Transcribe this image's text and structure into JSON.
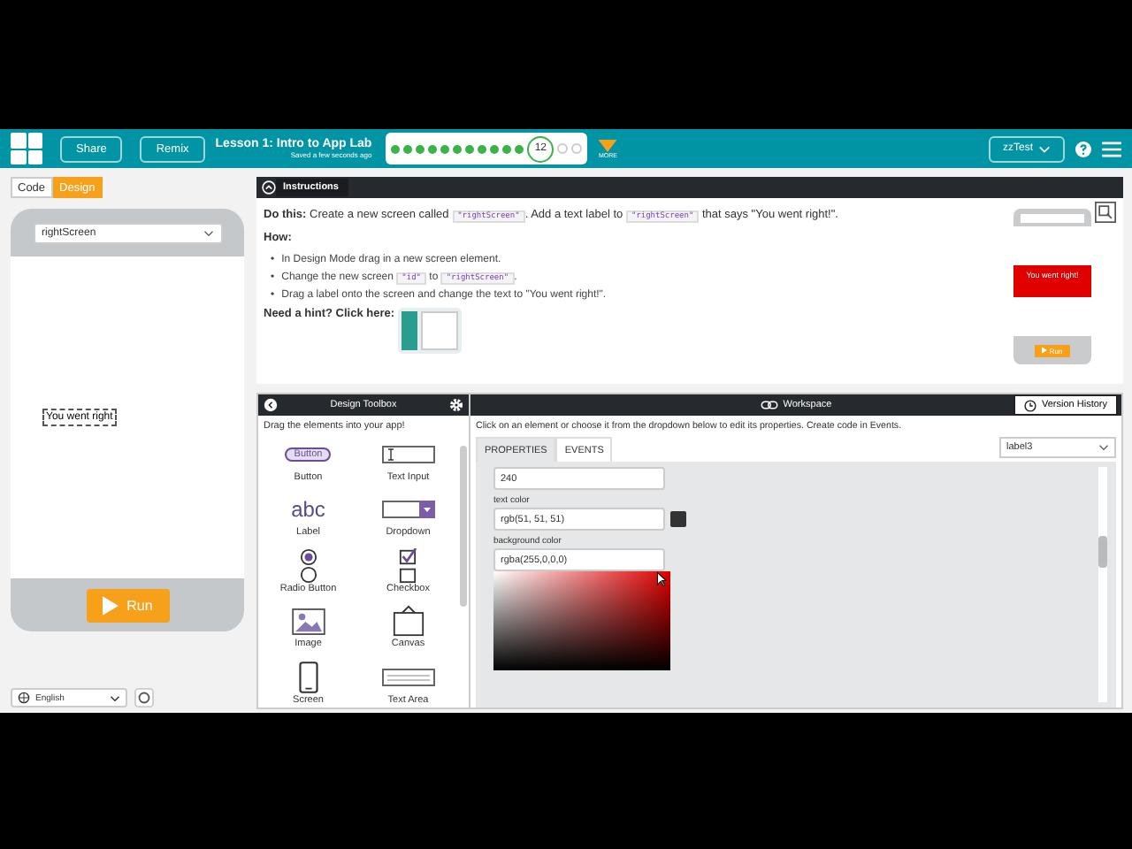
{
  "header": {
    "share": "Share",
    "remix": "Remix",
    "lesson_title": "Lesson 1: Intro to App Lab",
    "save_status": "Saved a few seconds ago",
    "more": "MORE",
    "user": "zzTest",
    "progress": [
      {
        "kind": "done"
      },
      {
        "kind": "done"
      },
      {
        "kind": "done"
      },
      {
        "kind": "done"
      },
      {
        "kind": "done"
      },
      {
        "kind": "done"
      },
      {
        "kind": "done"
      },
      {
        "kind": "done"
      },
      {
        "kind": "done"
      },
      {
        "kind": "done"
      },
      {
        "kind": "done"
      },
      {
        "kind": "current",
        "label": "12"
      },
      {
        "kind": "todo"
      },
      {
        "kind": "todo"
      }
    ]
  },
  "mode_tabs": [
    {
      "label": "Code",
      "selected": false
    },
    {
      "label": "Design",
      "selected": true
    }
  ],
  "app_preview": {
    "screen": "rightScreen",
    "label_text": "You went right",
    "run": "Run"
  },
  "language": "English",
  "instructions": {
    "title": "Instructions",
    "do_this": [
      {
        "kind": "bold",
        "text": "Do this:"
      },
      {
        "kind": "text",
        "text": " Create a new screen called "
      },
      {
        "kind": "code",
        "text": "\"rightScreen\""
      },
      {
        "kind": "text",
        "text": ". Add a text label to "
      },
      {
        "kind": "code",
        "text": "\"rightScreen\""
      },
      {
        "kind": "text",
        "text": " that says \"You went right!\"."
      }
    ],
    "how": "How:",
    "bullet": "•",
    "steps": [
      [
        {
          "kind": "text",
          "text": "In Design Mode drag in a new screen element."
        }
      ],
      [
        {
          "kind": "text",
          "text": "Change the new screen "
        },
        {
          "kind": "code",
          "text": "\"id\""
        },
        {
          "kind": "text",
          "text": " to "
        },
        {
          "kind": "code",
          "text": "\"rightScreen\""
        },
        {
          "kind": "text",
          "text": "."
        }
      ],
      [
        {
          "kind": "text",
          "text": "Drag a label onto the screen and change the text to \"You went right!\"."
        }
      ]
    ],
    "hint": "Need a hint? Click here:",
    "example": {
      "label_text": "You went right!",
      "run": "Run"
    }
  },
  "toolbox": {
    "title": "Design Toolbox",
    "subtitle": "Drag the elements into your app!",
    "items": [
      {
        "kind": "button",
        "label": "Button",
        "icon_text": "Button"
      },
      {
        "kind": "text_input",
        "label": "Text Input"
      },
      {
        "kind": "label",
        "label": "Label",
        "icon_text": "abc"
      },
      {
        "kind": "dropdown",
        "label": "Dropdown"
      },
      {
        "kind": "radio",
        "label": "Radio Button"
      },
      {
        "kind": "checkbox",
        "label": "Checkbox"
      },
      {
        "kind": "image",
        "label": "Image"
      },
      {
        "kind": "canvas",
        "label": "Canvas"
      },
      {
        "kind": "screen",
        "label": "Screen"
      },
      {
        "kind": "text_area",
        "label": "Text Area"
      }
    ]
  },
  "workspace": {
    "title": "Workspace",
    "version_history": "Version History",
    "hint": "Click on an element or choose it from the dropdown below to edit its properties. Create code in Events.",
    "tabs": [
      {
        "label": "PROPERTIES",
        "selected": true
      },
      {
        "label": "EVENTS",
        "selected": false
      }
    ],
    "element": "label3",
    "properties": [
      {
        "value": "240"
      },
      {
        "label": "text color",
        "value": "rgb(51, 51, 51)",
        "color": "#333333"
      },
      {
        "label": "background color",
        "value": "rgba(255,0,0,0)",
        "picker_open": true
      }
    ]
  }
}
